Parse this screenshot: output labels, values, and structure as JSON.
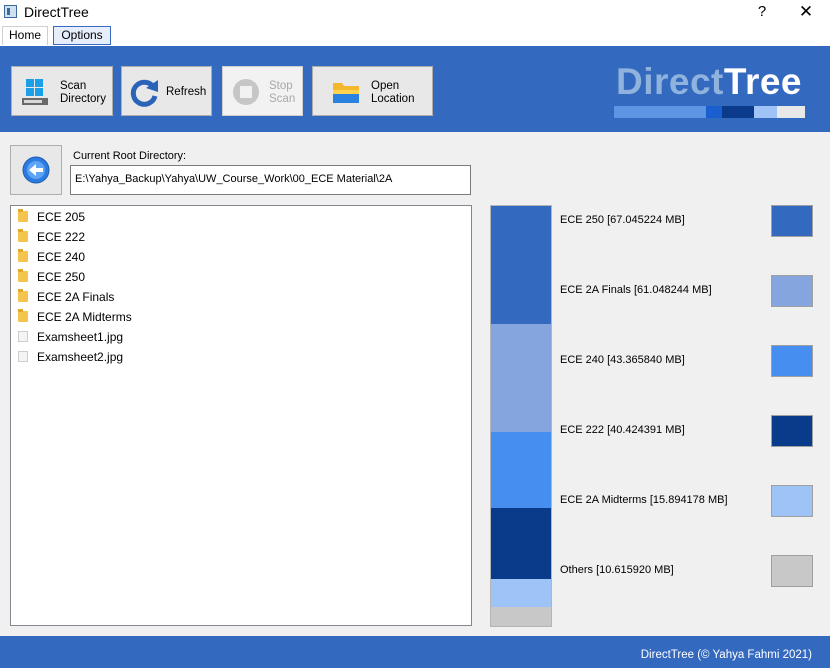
{
  "window": {
    "title": "DirectTree",
    "help_label": "?",
    "close_label": "✕"
  },
  "menu": {
    "tabs": [
      {
        "label": "Home"
      },
      {
        "label": "Options"
      }
    ]
  },
  "toolbar": {
    "scan": {
      "label": "Scan\nDirectory",
      "icon": "windows-drive-icon"
    },
    "refresh": {
      "label": "Refresh",
      "icon": "refresh-icon"
    },
    "stop": {
      "label": "Stop\nScan",
      "icon": "stop-icon",
      "disabled": true
    },
    "open": {
      "label": "Open\nLocation",
      "icon": "folder-open-icon"
    }
  },
  "brand": {
    "part1": "Direct",
    "part2": "Tree"
  },
  "root": {
    "label": "Current Root Directory:",
    "path": "E:\\Yahya_Backup\\Yahya\\UW_Course_Work\\00_ECE Material\\2A"
  },
  "tree": {
    "items": [
      {
        "label": "ECE 205",
        "type": "folder"
      },
      {
        "label": "ECE 222",
        "type": "folder"
      },
      {
        "label": "ECE 240",
        "type": "folder"
      },
      {
        "label": "ECE 250",
        "type": "folder"
      },
      {
        "label": "ECE 2A Finals",
        "type": "folder"
      },
      {
        "label": "ECE 2A Midterms",
        "type": "folder"
      },
      {
        "label": "Examsheet1.jpg",
        "type": "file"
      },
      {
        "label": "Examsheet2.jpg",
        "type": "file"
      }
    ]
  },
  "breakdown": {
    "items": [
      {
        "label": "ECE 250 [67.045224 MB]",
        "size_mb": 67.045224,
        "color": "#3469c0"
      },
      {
        "label": "ECE 2A Finals [61.048244 MB]",
        "size_mb": 61.048244,
        "color": "#84a5dd"
      },
      {
        "label": "ECE 240 [43.365840 MB]",
        "size_mb": 43.36584,
        "color": "#468ef0"
      },
      {
        "label": "ECE 222 [40.424391 MB]",
        "size_mb": 40.424391,
        "color": "#0a3a8a"
      },
      {
        "label": "ECE 2A Midterms [15.894178 MB]",
        "size_mb": 15.894178,
        "color": "#9ec3f7"
      },
      {
        "label": "Others [10.615920 MB]",
        "size_mb": 10.61592,
        "color": "#c8c8c8"
      }
    ]
  },
  "colors": {
    "accent": "#3469c0",
    "brand_light": "#8fb3dd"
  },
  "footer": {
    "text": "DirectTree (© Yahya Fahmi 2021)"
  }
}
